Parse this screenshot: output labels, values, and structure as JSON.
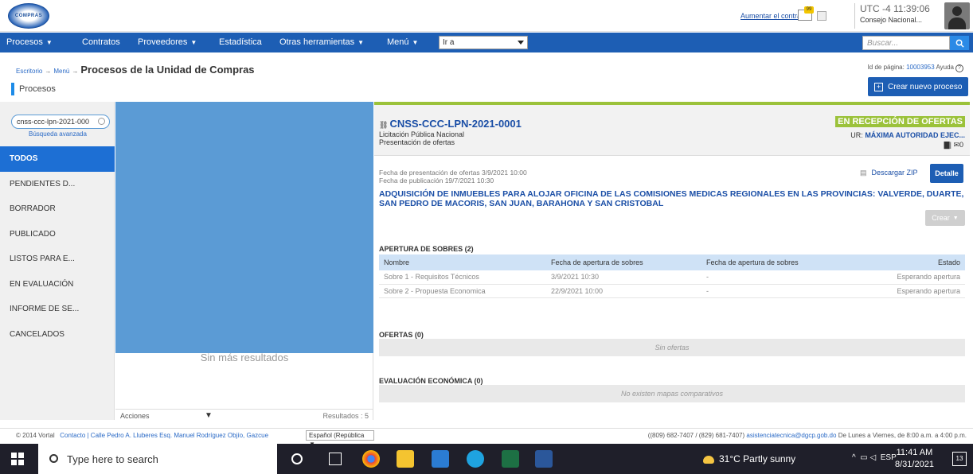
{
  "header": {
    "logo_text": "COMPRAS",
    "contrast_link": "Aumentar el contraste",
    "mail_badge": "99",
    "clock": "UTC -4 11:39:06",
    "user": "Consejo Nacional..."
  },
  "nav": {
    "items": [
      "Procesos",
      "Contratos",
      "Proveedores",
      "Estadística",
      "Otras herramientas",
      "Menú"
    ],
    "goto_value": "Ir a",
    "search_placeholder": "Buscar..."
  },
  "breadcrumb": {
    "root": "Escritorio",
    "menu": "Menú",
    "current": "Procesos de la Unidad de Compras",
    "arrow": "→",
    "page_id_label": "Id de página:",
    "page_id": "10003953",
    "help": "Ayuda"
  },
  "section": {
    "title": "Procesos",
    "new_button": "Crear nuevo proceso"
  },
  "filters": {
    "search_value": "cnss-ccc-lpn-2021-000",
    "advanced": "Búsqueda avanzada",
    "status_items": [
      "TODOS",
      "PENDIENTES D...",
      "BORRADOR",
      "PUBLICADO",
      "LISTOS PARA E...",
      "EN EVALUACIÓN",
      "INFORME DE SE...",
      "CANCELADOS"
    ]
  },
  "results": {
    "no_more": "Sin más resultados",
    "actions": "Acciones",
    "count": "Resultados : 5"
  },
  "detail": {
    "code": "CNSS-CCC-LPN-2021-0001",
    "type": "Licitación Pública Nacional",
    "stage": "Presentación de ofertas",
    "status": "EN RECEPCIÓN DE OFERTAS",
    "ur_label": "UR:",
    "ur_value": "MÁXIMA AUTORIDAD EJEC...",
    "folder_count": "0",
    "presentation_date": "Fecha de presentación de ofertas 3/9/2021 10:00",
    "publication_date": "Fecha de publicación 19/7/2021 10:30",
    "zip": "Descargar ZIP",
    "detail_button": "Detalle",
    "description": "ADQUISICIÓN DE INMUEBLES PARA ALOJAR OFICINA DE LAS COMISIONES MEDICAS REGIONALES EN LAS PROVINCIAS: VALVERDE, DUARTE, SAN PEDRO DE MACORIS, SAN JUAN, BARAHONA Y SAN CRISTOBAL",
    "create_button": "Crear",
    "envelopes": {
      "title": "APERTURA DE SOBRES (2)",
      "headers": [
        "Nombre",
        "Fecha de apertura de sobres",
        "Fecha de apertura de sobres",
        "Estado"
      ],
      "rows": [
        [
          "Sobre 1 - Requisitos Técnicos",
          "3/9/2021 10:30",
          "-",
          "Esperando apertura"
        ],
        [
          "Sobre 2 - Propuesta Economica",
          "22/9/2021 10:00",
          "-",
          "Esperando apertura"
        ]
      ]
    },
    "offers": {
      "title": "OFERTAS (0)",
      "empty": "Sin ofertas"
    },
    "evaluation": {
      "title": "EVALUACIÓN ECONÓMICA (0)",
      "empty": "No existen mapas comparativos"
    }
  },
  "footer": {
    "copyright": "© 2014 Vortal",
    "contact": "Contacto | Calle Pedro A. Lluberes Esq. Manuel Rodríguez Objío, Gazcue",
    "language": "Español (República",
    "phones": "((809) 682-7407 / (829) 681-7407)",
    "email": "asistenciatecnica@dgcp.gob.do",
    "hours": "De Lunes a Viernes, de 8:00 a.m. a 4:00 p.m."
  },
  "taskbar": {
    "search": "Type here to search",
    "weather": "31°C  Partly sunny",
    "lang": "ESP",
    "time": "11:41 AM",
    "date": "8/31/2021",
    "notifications": "13"
  },
  "colors": {
    "nav_blue": "#1d5eb4",
    "active_blue": "#1d6fd4",
    "status_green": "#9bc23a",
    "redaction": "#5b9bd5"
  }
}
